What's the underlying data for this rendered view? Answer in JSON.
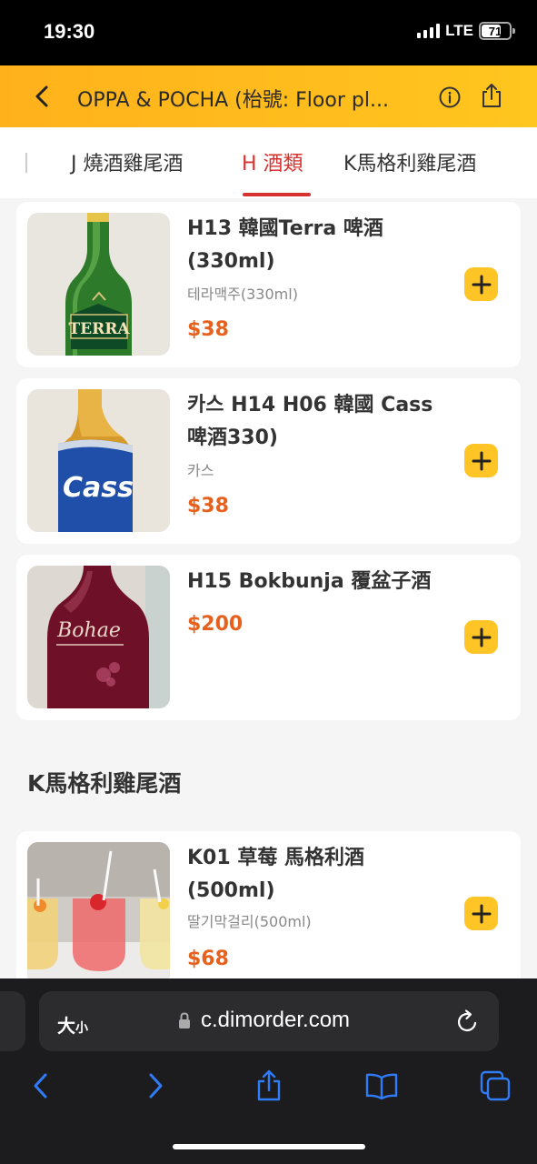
{
  "status_bar": {
    "time": "19:30",
    "network": "LTE",
    "battery": "71",
    "battery_level": 0.71
  },
  "header": {
    "title": "OPPA & POCHA (枱號: Floor pl..."
  },
  "tabs": [
    {
      "label": "J 燒酒雞尾酒",
      "active": false
    },
    {
      "label": "H 酒類",
      "active": true
    },
    {
      "label": "K馬格利雞尾酒",
      "active": false
    }
  ],
  "items": [
    {
      "name_line1": "H13 韓國Terra 啤酒",
      "name_line2": "(330ml)",
      "subtitle": "테라맥주(330ml)",
      "price": "$38"
    },
    {
      "name_line1": "카스 H14 H06 韓國 Cass",
      "name_line2": "啤酒330)",
      "subtitle": "카스",
      "price": "$38"
    },
    {
      "name_line1": "H15 Bokbunja 覆盆子酒",
      "name_line2": "",
      "subtitle": "",
      "price": "$200"
    }
  ],
  "section": {
    "title": "K馬格利雞尾酒"
  },
  "section_items": [
    {
      "name_line1": "K01 草莓 馬格利酒",
      "name_line2": "(500ml)",
      "subtitle": "딸기막걸리(500ml)",
      "price": "$68"
    }
  ],
  "product_art": {
    "terra_label": "TERRA",
    "cass_label": "Cass",
    "bokbunja_label": "Bohae"
  },
  "browser": {
    "text_size_big": "大",
    "text_size_small": "小",
    "url": "c.dimorder.com"
  },
  "colors": {
    "accent": "#d6322f",
    "header": "#ffb11b",
    "price": "#e6611e",
    "add_button": "#ffc526"
  }
}
